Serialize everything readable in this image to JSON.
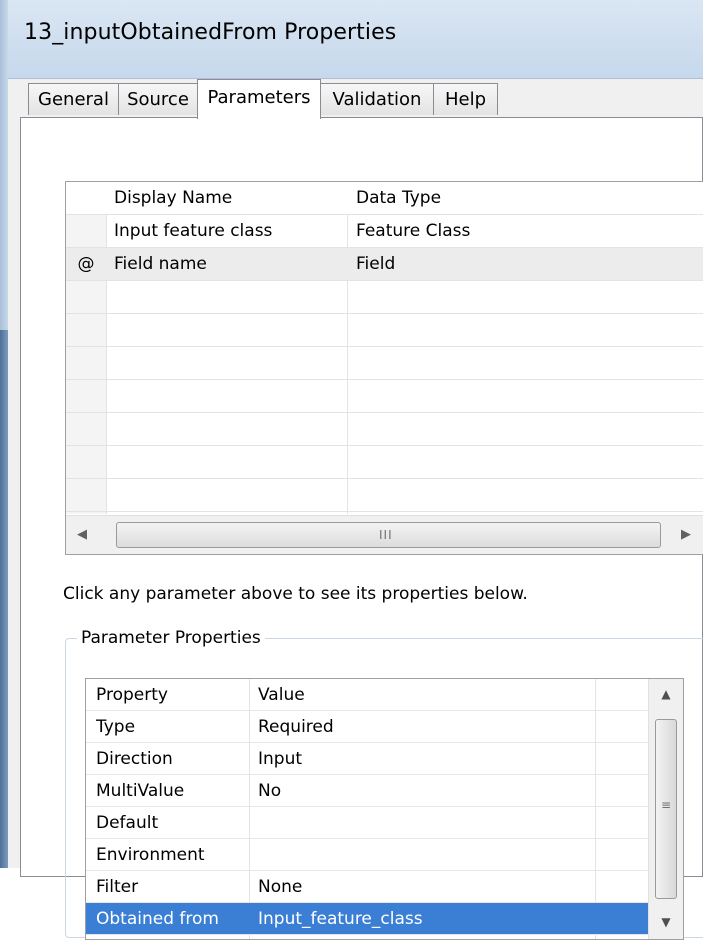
{
  "window": {
    "title": "13_inputObtainedFrom Properties"
  },
  "tabs": [
    {
      "label": "General"
    },
    {
      "label": "Source"
    },
    {
      "label": "Parameters"
    },
    {
      "label": "Validation"
    },
    {
      "label": "Help"
    }
  ],
  "active_tab": "Parameters",
  "parameters_table": {
    "headers": [
      "Display Name",
      "Data Type"
    ],
    "rows": [
      {
        "marker": "",
        "display_name": "Input feature class",
        "data_type": "Feature Class"
      },
      {
        "marker": "@",
        "display_name": "Field name",
        "data_type": "Field"
      }
    ],
    "scroll_grip": "III"
  },
  "hint": "Click any parameter above to see its properties below.",
  "parameter_properties": {
    "legend": "Parameter Properties",
    "headers": [
      "Property",
      "Value"
    ],
    "rows": [
      {
        "property": "Type",
        "value": "Required"
      },
      {
        "property": "Direction",
        "value": "Input"
      },
      {
        "property": "MultiValue",
        "value": "No"
      },
      {
        "property": "Default",
        "value": ""
      },
      {
        "property": "Environment",
        "value": ""
      },
      {
        "property": "Filter",
        "value": "None"
      },
      {
        "property": "Obtained from",
        "value": "Input_feature_class"
      }
    ],
    "selected_row": "Obtained from",
    "selection_color": "#3a7fd4"
  }
}
